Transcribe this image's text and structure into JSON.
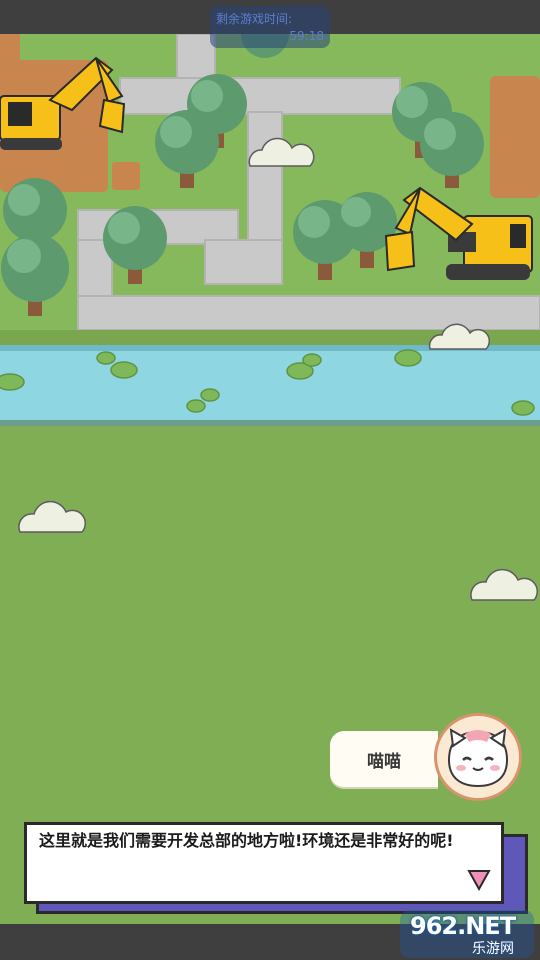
{
  "hud": {
    "timer_label": "剩余游戏时间:",
    "timer_value": "59:18"
  },
  "npc": {
    "name": "喵喵",
    "avatar_icon": "cat-face-icon"
  },
  "dialog": {
    "text": "这里就是我们需要开发总部的地方啦!环境还是非常好的呢!",
    "next_icon": "triangle-down-icon"
  },
  "watermark": {
    "brand": "962.NET",
    "sub": "乐游网"
  },
  "colors": {
    "grass": "#7fae55",
    "river": "#8fd6e3",
    "road": "#c9c9c9",
    "excavator": "#f6c018",
    "dialog_shadow": "#5f58b8",
    "avatar_border": "#d8936b"
  }
}
